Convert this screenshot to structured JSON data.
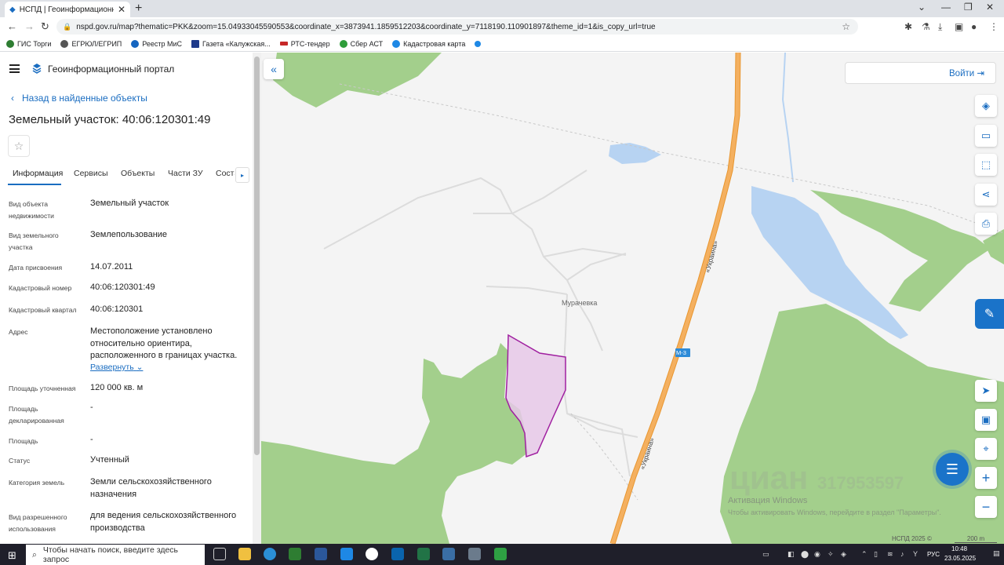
{
  "browser": {
    "tab_title": "НСПД | Геоинформационный п",
    "url": "nspd.gov.ru/map?thematic=PKK&zoom=15.04933045590553&coordinate_x=3873941.1859512203&coordinate_y=7118190.110901897&theme_id=1&is_copy_url=true",
    "bookmarks": [
      {
        "label": "ГИС Торги",
        "color": "#2e7d32"
      },
      {
        "label": "ЕГРЮЛ/ЕГРИП",
        "color": "#555555"
      },
      {
        "label": "Реестр МиС",
        "color": "#1565c0"
      },
      {
        "label": "Газета «Калужская...",
        "color": "#1e3a8a"
      },
      {
        "label": "РТС-тендер",
        "color": "#c62828"
      },
      {
        "label": "Сбер АСТ",
        "color": "#2e9d3a"
      },
      {
        "label": "Кадастровая карта",
        "color": "#1e88e5"
      }
    ]
  },
  "sidebar": {
    "portal_title": "Геоинформационный портал",
    "back_link": "Назад в найденные объекты",
    "object_title": "Земельный участок: 40:06:120301:49",
    "tabs": [
      {
        "label": "Информация"
      },
      {
        "label": "Сервисы"
      },
      {
        "label": "Объекты"
      },
      {
        "label": "Части ЗУ"
      },
      {
        "label": "Соста"
      }
    ],
    "properties": [
      {
        "label": "Вид объекта недвижимости",
        "value": "Земельный участок"
      },
      {
        "label": "Вид земельного участка",
        "value": "Землепользование"
      },
      {
        "label": "Дата присвоения",
        "value": "14.07.2011"
      },
      {
        "label": "Кадастровый номер",
        "value": "40:06:120301:49"
      },
      {
        "label": "Кадастровый квартал",
        "value": "40:06:120301"
      },
      {
        "label": "Адрес",
        "value": "Местоположение установлено относительно ориентира, расположенного в границах участка."
      },
      {
        "label": "Площадь уточненная",
        "value": "120 000 кв. м"
      },
      {
        "label": "Площадь декларированная",
        "value": "-"
      },
      {
        "label": "Площадь",
        "value": "-"
      },
      {
        "label": "Статус",
        "value": "Учтенный"
      },
      {
        "label": "Категория земель",
        "value": "Земли сельскохозяйственного назначения"
      },
      {
        "label": "Вид разрешенного использования",
        "value": "для ведения сельскохозяйственного производства"
      }
    ],
    "expand_link": "Развернуть"
  },
  "map": {
    "login_label": "Войти",
    "village_label": "Мурачевка",
    "road_label_1": "«Украина»",
    "road_label_2": "«Украина»",
    "road_shield": "М-3",
    "watermark": "циан",
    "watermark_phone": "317953597",
    "activation_title": "Активация Windows",
    "activation_text": "Чтобы активировать Windows, перейдите в раздел \"Параметры\".",
    "copyright": "НСПД 2025 ©",
    "scale": "200 m",
    "colors": {
      "forest": "#a3cf8c",
      "water": "#b7d3f2",
      "road": "#f2a950",
      "parcel_fill": "#e6c8e8",
      "parcel_stroke": "#a020a0",
      "accent": "#1a6dc1"
    }
  },
  "taskbar": {
    "search_placeholder": "Чтобы начать поиск, введите здесь запрос",
    "lang": "РУС",
    "time": "10:48",
    "date": "23.05.2025"
  }
}
